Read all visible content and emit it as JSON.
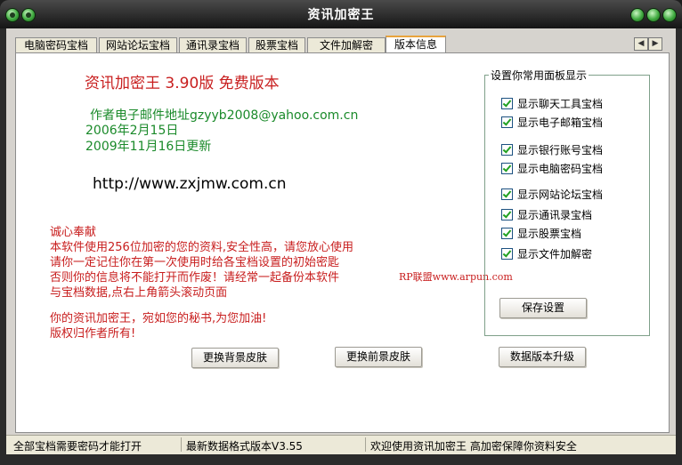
{
  "window": {
    "title": "资讯加密王"
  },
  "tabs": [
    "电脑密码宝档",
    "网站论坛宝档",
    "通讯录宝档",
    "股票宝档",
    "文件加解密",
    "版本信息"
  ],
  "active_tab": 5,
  "tab_scroll": {
    "left": "◀",
    "right": "▶"
  },
  "info": {
    "heading": "资讯加密王 3.90版 免费版本",
    "email": "作者电子邮件地址gzyyb2008@yahoo.com.cn",
    "date1": "2006年2月15日",
    "date2": "2009年11月16日更新",
    "website": "http://www.zxjmw.com.cn"
  },
  "notice": {
    "line1": "诚心奉献",
    "line2": "本软件使用256位加密的您的资料,安全性高，请您放心使用",
    "line3": "请你一定记住你在第一次使用时给各宝档设置的初始密匙",
    "line4": "否则你的信息将不能打开而作废！请经常一起备份本软件",
    "line5": "与宝档数据,点右上角箭头滚动页面",
    "line6": "你的资讯加密王，宛如您的秘书,为您加油!",
    "line7": "版权归作者所有!",
    "watermark": "RP联盟www.arpun.com"
  },
  "panel": {
    "legend": "设置你常用面板显示",
    "options": [
      "显示聊天工具宝档",
      "显示电子邮箱宝档",
      "显示银行账号宝档",
      "显示电脑密码宝档",
      "显示网站论坛宝档",
      "显示通讯录宝档",
      "显示股票宝档",
      "显示文件加解密"
    ],
    "checked": [
      true,
      true,
      true,
      true,
      true,
      true,
      true,
      true
    ],
    "save_button": "保存设置"
  },
  "buttons": {
    "bg_skin": "更换背景皮肤",
    "fg_skin": "更换前景皮肤",
    "upgrade": "数据版本升级"
  },
  "status": {
    "s1": "全部宝档需要密码才能打开",
    "s2": "最新数据格式版本V3.55",
    "s3": "欢迎使用资讯加密王 高加密保障你资料安全"
  }
}
